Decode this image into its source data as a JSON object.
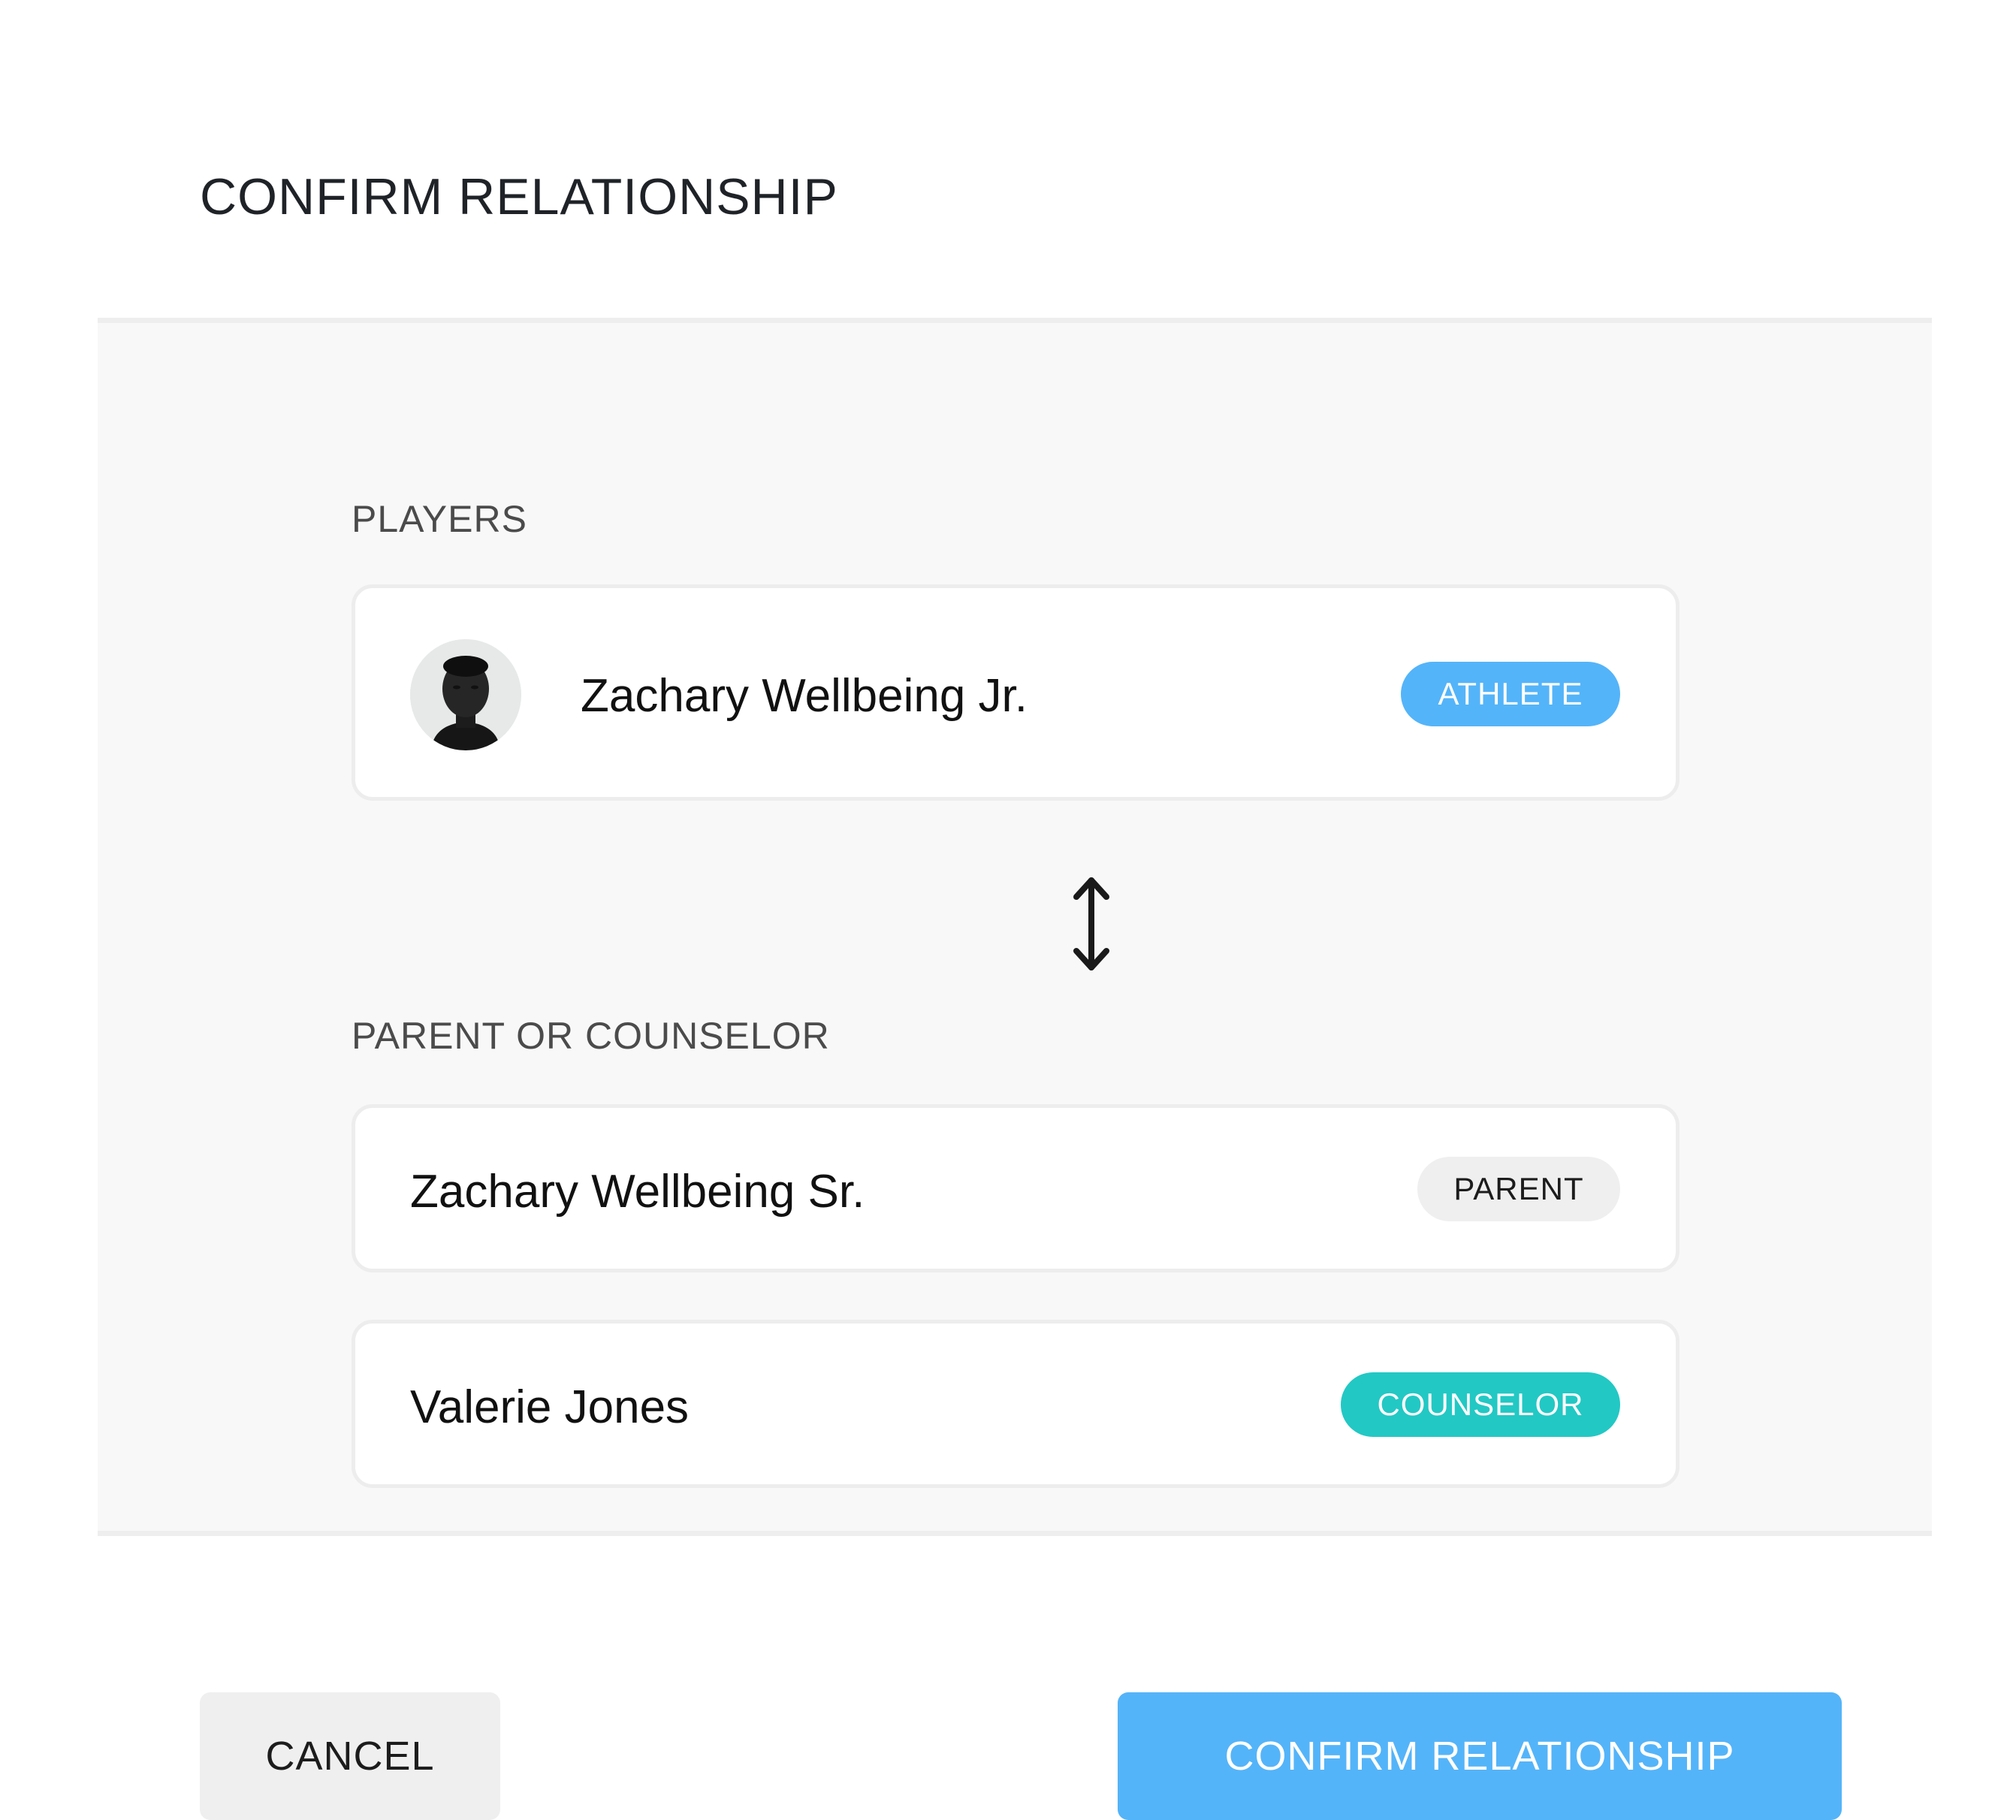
{
  "dialog": {
    "title": "CONFIRM RELATIONSHIP"
  },
  "players_section": {
    "label": "PLAYERS",
    "player": {
      "name": "Zachary Wellbeing Jr.",
      "role": "ATHLETE",
      "avatar_icon": "person-photo"
    }
  },
  "relationship_icon": "swap-vertical-arrow-icon",
  "guardians_section": {
    "label": "PARENT OR COUNSELOR",
    "people": [
      {
        "name": "Zachary Wellbeing Sr.",
        "role": "PARENT"
      },
      {
        "name": "Valerie Jones",
        "role": "COUNSELOR"
      }
    ]
  },
  "footer": {
    "cancel_label": "CANCEL",
    "confirm_label": "CONFIRM RELATIONSHIP"
  },
  "colors": {
    "primary": "#54b4f9",
    "athlete_badge": "#54b4f9",
    "parent_badge": "#efefef",
    "counselor_badge": "#22c8c4",
    "body_background": "#f8f8f8"
  }
}
